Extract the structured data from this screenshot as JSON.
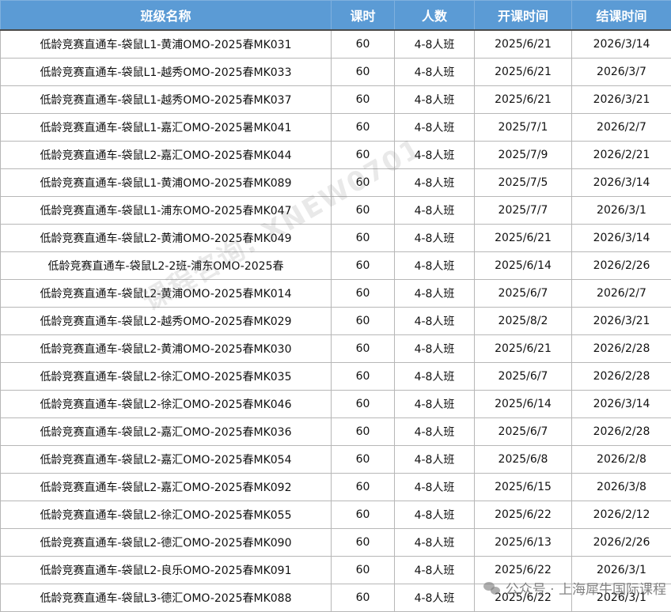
{
  "table": {
    "headers": [
      "班级名称",
      "课时",
      "人数",
      "开课时间",
      "结课时间"
    ],
    "rows": [
      [
        "低龄竞赛直通车-袋鼠L1-黄浦OMO-2025春MK031",
        "60",
        "4-8人班",
        "2025/6/21",
        "2026/3/14"
      ],
      [
        "低龄竞赛直通车-袋鼠L1-越秀OMO-2025春MK033",
        "60",
        "4-8人班",
        "2025/6/21",
        "2026/3/7"
      ],
      [
        "低龄竞赛直通车-袋鼠L1-越秀OMO-2025春MK037",
        "60",
        "4-8人班",
        "2025/6/21",
        "2026/3/21"
      ],
      [
        "低龄竞赛直通车-袋鼠L1-嘉汇OMO-2025暑MK041",
        "60",
        "4-8人班",
        "2025/7/1",
        "2026/2/7"
      ],
      [
        "低龄竞赛直通车-袋鼠L2-嘉汇OMO-2025春MK044",
        "60",
        "4-8人班",
        "2025/7/9",
        "2026/2/21"
      ],
      [
        "低龄竞赛直通车-袋鼠L1-黄浦OMO-2025春MK089",
        "60",
        "4-8人班",
        "2025/7/5",
        "2026/3/14"
      ],
      [
        "低龄竞赛直通车-袋鼠L1-浦东OMO-2025春MK047",
        "60",
        "4-8人班",
        "2025/7/7",
        "2026/3/1"
      ],
      [
        "低龄竞赛直通车-袋鼠L2-黄浦OMO-2025春MK049",
        "60",
        "4-8人班",
        "2025/6/21",
        "2026/3/14"
      ],
      [
        "低龄竞赛直通车-袋鼠L2-2班-浦东OMO-2025春",
        "60",
        "4-8人班",
        "2025/6/14",
        "2026/2/26"
      ],
      [
        "低龄竞赛直通车-袋鼠L2-黄浦OMO-2025春MK014",
        "60",
        "4-8人班",
        "2025/6/7",
        "2026/2/7"
      ],
      [
        "低龄竞赛直通车-袋鼠L2-越秀OMO-2025春MK029",
        "60",
        "4-8人班",
        "2025/8/2",
        "2026/3/21"
      ],
      [
        "低龄竞赛直通车-袋鼠L2-黄浦OMO-2025春MK030",
        "60",
        "4-8人班",
        "2025/6/21",
        "2026/2/28"
      ],
      [
        "低龄竞赛直通车-袋鼠L2-徐汇OMO-2025春MK035",
        "60",
        "4-8人班",
        "2025/6/7",
        "2026/2/28"
      ],
      [
        "低龄竞赛直通车-袋鼠L2-徐汇OMO-2025春MK046",
        "60",
        "4-8人班",
        "2025/6/14",
        "2026/3/14"
      ],
      [
        "低龄竞赛直通车-袋鼠L2-嘉汇OMO-2025春MK036",
        "60",
        "4-8人班",
        "2025/6/7",
        "2026/2/28"
      ],
      [
        "低龄竞赛直通车-袋鼠L2-嘉汇OMO-2025春MK054",
        "60",
        "4-8人班",
        "2025/6/8",
        "2026/2/8"
      ],
      [
        "低龄竞赛直通车-袋鼠L2-嘉汇OMO-2025春MK092",
        "60",
        "4-8人班",
        "2025/6/15",
        "2026/3/8"
      ],
      [
        "低龄竞赛直通车-袋鼠L2-徐汇OMO-2025春MK055",
        "60",
        "4-8人班",
        "2025/6/22",
        "2026/2/12"
      ],
      [
        "低龄竞赛直通车-袋鼠L2-德汇OMO-2025春MK090",
        "60",
        "4-8人班",
        "2025/6/13",
        "2026/2/26"
      ],
      [
        "低龄竞赛直通车-袋鼠L2-良乐OMO-2025春MK091",
        "60",
        "4-8人班",
        "2025/6/22",
        "2026/3/1"
      ],
      [
        "低龄竞赛直通车-袋鼠L3-德汇OMO-2025春MK088",
        "60",
        "4-8人班",
        "2025/6/22",
        "2026/3/1"
      ]
    ]
  },
  "watermark": {
    "text": "课程咨询: XNEW0701"
  },
  "footer_watermark": {
    "icon": "wechat-icon",
    "text": "公众号 · 上海犀牛国际课程"
  }
}
